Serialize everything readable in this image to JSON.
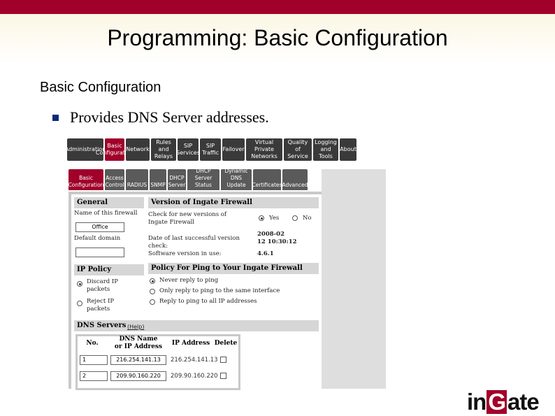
{
  "slide": {
    "title": "Programming: Basic Configuration",
    "subtitle": "Basic Configuration",
    "bullet": "Provides DNS Server addresses."
  },
  "main_nav": [
    {
      "label": "Administration",
      "active": false
    },
    {
      "label": "Basic\nConfiguration",
      "active": true
    },
    {
      "label": "Network",
      "active": false
    },
    {
      "label": "Rules and\nRelays",
      "active": false
    },
    {
      "label": "SIP\nServices",
      "active": false
    },
    {
      "label": "SIP\nTraffic",
      "active": false
    },
    {
      "label": "Failover",
      "active": false
    },
    {
      "label": "Virtual Private\nNetworks",
      "active": false
    },
    {
      "label": "Quality of\nService",
      "active": false
    },
    {
      "label": "Logging\nand Tools",
      "active": false
    },
    {
      "label": "About",
      "active": false
    }
  ],
  "sub_nav": [
    {
      "label": "Basic\nConfiguration",
      "active": true
    },
    {
      "label": "Access\nControl",
      "active": false
    },
    {
      "label": "RADIUS",
      "active": false
    },
    {
      "label": "SNMP",
      "active": false
    },
    {
      "label": "DHCP\nServer",
      "active": false
    },
    {
      "label": "DHCP\nServer Status",
      "active": false
    },
    {
      "label": "Dynamic\nDNS Update",
      "active": false
    },
    {
      "label": "Certificates",
      "active": false
    },
    {
      "label": "Advanced",
      "active": false
    }
  ],
  "general": {
    "heading": "General",
    "firewall_name_label": "Name of this firewall",
    "firewall_name_value": "Office",
    "default_domain_label": "Default domain",
    "default_domain_value": ""
  },
  "version": {
    "heading": "Version of Ingate Firewall",
    "check_label": "Check for new versions of Ingate Firewall",
    "yes_label": "Yes",
    "no_label": "No",
    "last_check_label": "Date of last successful version check:",
    "last_check_value": "2008-02\n12 10:30:12",
    "software_label": "Software version in use:",
    "software_value": "4.6.1"
  },
  "ip_policy": {
    "heading": "IP Policy",
    "options": [
      "Discard IP packets",
      "Reject IP packets"
    ],
    "selected": 0
  },
  "ping_policy": {
    "heading": "Policy For Ping to Your Ingate Firewall",
    "options": [
      "Never reply to ping",
      "Only reply to ping to the same interface",
      "Reply to ping to all IP addresses"
    ],
    "selected": 0
  },
  "dns": {
    "heading": "DNS Servers",
    "help": "(Help)",
    "columns": [
      "No.",
      "DNS Name\nor IP Address",
      "IP Address",
      "Delete"
    ],
    "rows": [
      {
        "no": "1",
        "name": "216.254.141.13",
        "ip": "216.254.141.13"
      },
      {
        "no": "2",
        "name": "209.90.160.220",
        "ip": "209.90.160.220"
      }
    ]
  },
  "logo": {
    "left": "in",
    "middle": "G",
    "right": "ate"
  },
  "colors": {
    "brand": "#a0002a",
    "nav": "#3a3a3a",
    "section": "#d6d6d6"
  }
}
